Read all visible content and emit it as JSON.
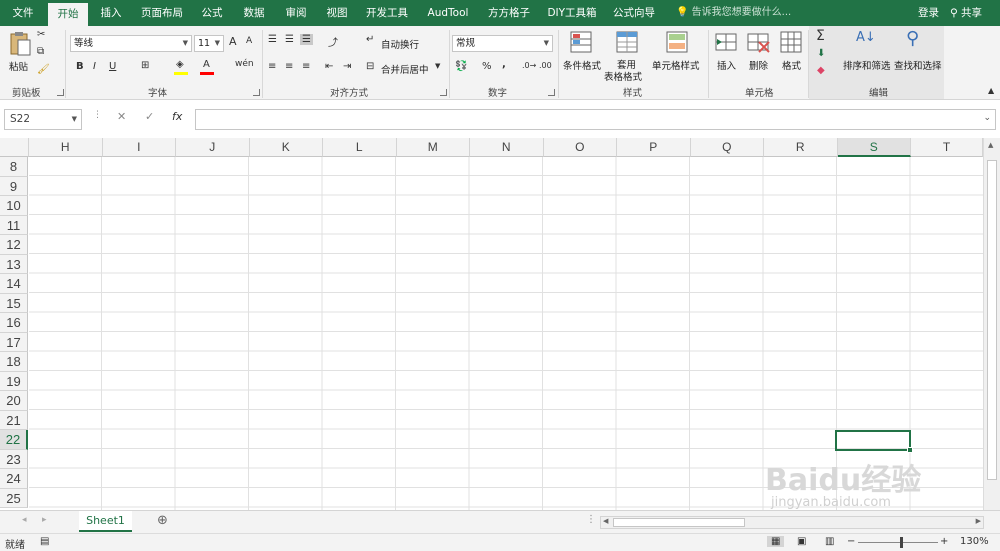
{
  "menu": {
    "tabs": [
      "文件",
      "开始",
      "插入",
      "页面布局",
      "公式",
      "数据",
      "审阅",
      "视图",
      "开发工具",
      "AudTool",
      "方方格子",
      "DIY工具箱",
      "公式向导"
    ],
    "active": "开始",
    "tell_me": "告诉我您想要做什么...",
    "login": "登录",
    "share": "共享"
  },
  "ribbon": {
    "clipboard": {
      "paste": "粘贴",
      "group": "剪贴板"
    },
    "font": {
      "name": "等线",
      "size": "11",
      "bold": "B",
      "italic": "I",
      "underline": "U",
      "grow": "A",
      "shrink": "A",
      "group": "字体"
    },
    "align": {
      "wrap": "自动换行",
      "merge": "合并后居中",
      "group": "对齐方式"
    },
    "number": {
      "format": "常规",
      "percent": "%",
      "comma": ",",
      "group": "数字"
    },
    "styles": {
      "cond": "条件格式",
      "table1": "套用",
      "table2": "表格格式",
      "cell": "单元格样式",
      "group": "样式"
    },
    "cells": {
      "insert": "插入",
      "delete": "删除",
      "format": "格式",
      "group": "单元格"
    },
    "editing": {
      "sort": "排序和筛选",
      "find": "查找和选择",
      "group": "编辑"
    }
  },
  "formula_bar": {
    "name_box": "S22",
    "fx": "fx",
    "value": ""
  },
  "grid": {
    "columns": [
      "H",
      "I",
      "J",
      "K",
      "L",
      "M",
      "N",
      "O",
      "P",
      "Q",
      "R",
      "S",
      "T"
    ],
    "selected_column": "S",
    "rows": [
      "8",
      "9",
      "10",
      "11",
      "12",
      "13",
      "14",
      "15",
      "16",
      "17",
      "18",
      "19",
      "20",
      "21",
      "22",
      "23",
      "24",
      "25"
    ],
    "selected_row": "22"
  },
  "sheets": {
    "tabs": [
      "Sheet1"
    ],
    "active": "Sheet1"
  },
  "status": {
    "ready": "就绪",
    "zoom": "130%"
  },
  "watermark": {
    "text": "Baidu经验",
    "url": "jingyan.baidu.com"
  },
  "colors": {
    "accent": "#217346",
    "ribbon_bg": "#f3f3f3"
  }
}
